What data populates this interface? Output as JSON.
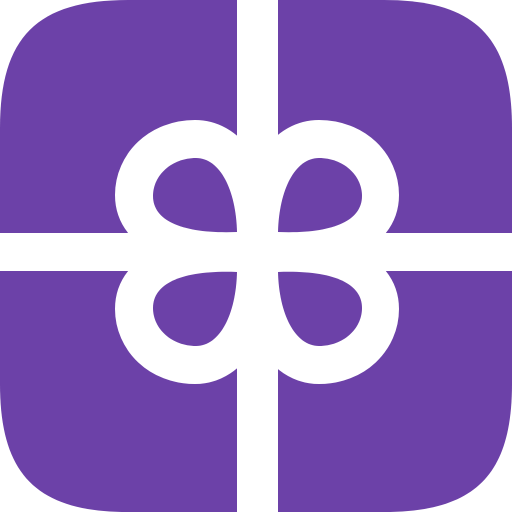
{
  "icon": {
    "name": "gift-icon",
    "colors": {
      "background": "#6c41a8",
      "ribbon": "#ffffff",
      "page": "#ffffff"
    }
  }
}
